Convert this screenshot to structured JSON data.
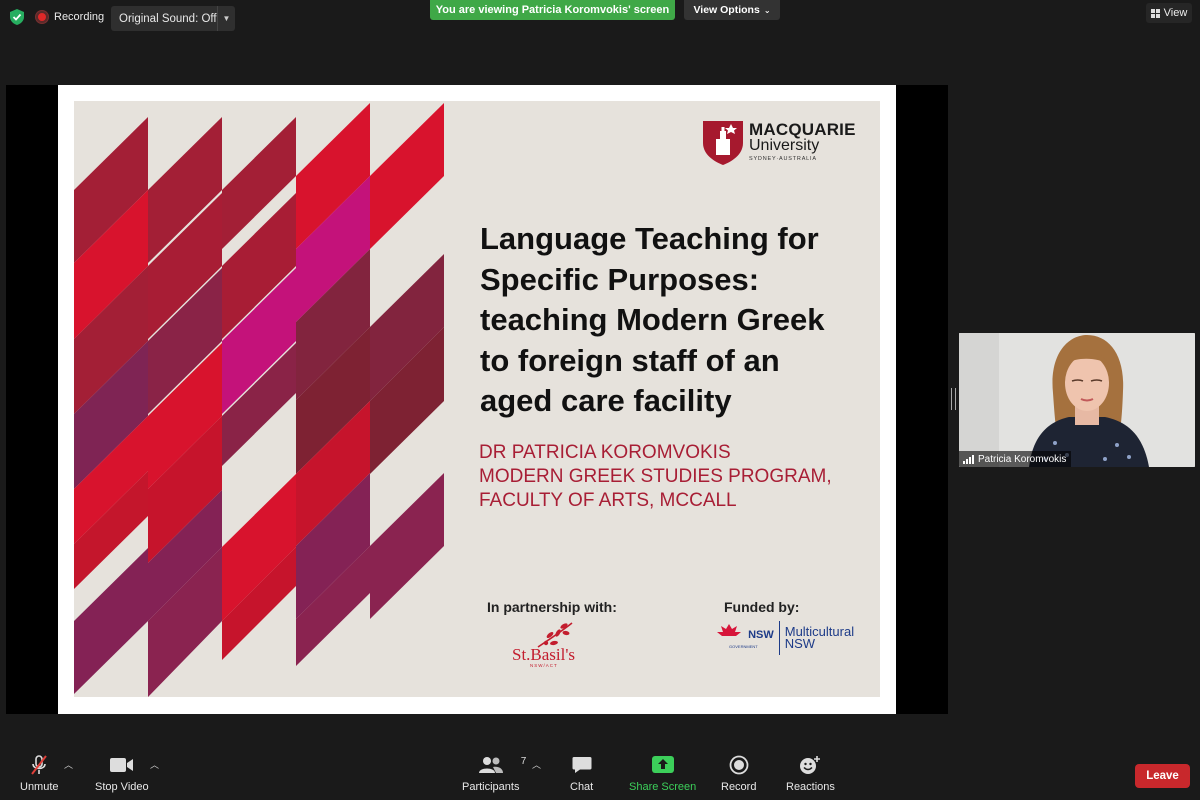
{
  "topbar": {
    "recording_label": "Recording",
    "original_sound_label": "Original Sound: Off",
    "viewing_banner": "You are viewing Patricia Koromvokis' screen",
    "view_options_label": "View Options",
    "view_label": "View"
  },
  "slide": {
    "university_name_line1": "MACQUARIE",
    "university_name_line2": "University",
    "university_location": "SYDNEY·AUSTRALIA",
    "title_lines": [
      "Language Teaching for",
      "Specific Purposes:",
      "teaching Modern Greek",
      "to foreign staff of an",
      "aged care facility"
    ],
    "subtitle_lines": [
      "DR PATRICIA KOROMVOKIS",
      "MODERN GREEK STUDIES PROGRAM,",
      "FACULTY OF ARTS, MCCALL"
    ],
    "partnership_label": "In partnership with:",
    "funded_label": "Funded by:",
    "partner_name": "St.Basil's",
    "partner_sub": "NSW/ACT",
    "funder_gov": "NSW",
    "funder_gov_sub": "GOVERNMENT",
    "funder_line1": "Multicultural",
    "funder_line2": "NSW"
  },
  "video": {
    "participant_name": "Patricia Koromvokis"
  },
  "toolbar": {
    "unmute_label": "Unmute",
    "stop_video_label": "Stop Video",
    "participants_label": "Participants",
    "participants_count": "7",
    "chat_label": "Chat",
    "share_screen_label": "Share Screen",
    "record_label": "Record",
    "reactions_label": "Reactions",
    "leave_label": "Leave"
  },
  "colors": {
    "share_green": "#3fa847",
    "leave_red": "#c8282c",
    "slide_bg": "#e6e2dc",
    "subtitle_red": "#a81e35"
  }
}
